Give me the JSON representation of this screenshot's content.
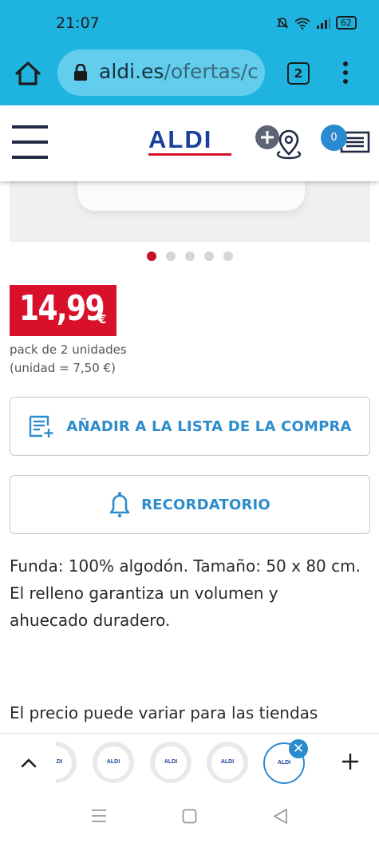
{
  "status_bar": {
    "time": "21:07",
    "battery": "62"
  },
  "browser": {
    "url_host": "aldi.es",
    "url_path": "/ofertas/c",
    "tab_count": "2"
  },
  "site_header": {
    "logo": "ALDI",
    "cart_count": "0"
  },
  "carousel": {
    "total_slides": 5,
    "active_index": 0
  },
  "product": {
    "price": "14,99",
    "currency": "€",
    "pack": "pack de 2 unidades",
    "unit_price": "(unidad = 7,50 €)",
    "add_to_list_label": "AÑADIR A LA LISTA DE LA COMPRA",
    "reminder_label": "RECORDATORIO",
    "description": "Funda: 100% algodón. Tamaño: 50 x 80 cm. El relleno garantiza un volumen y ahuecado duradero.",
    "price_note": "El precio puede variar para las tiendas"
  },
  "tab_strip": {
    "tab_logo": "ALDI"
  },
  "colors": {
    "browser_bar": "#1fb4e0",
    "aldi_blue": "#1a3f9c",
    "price_red": "#d8102a",
    "link_blue": "#2d8ccc",
    "badge_blue": "#2b8bd0"
  }
}
